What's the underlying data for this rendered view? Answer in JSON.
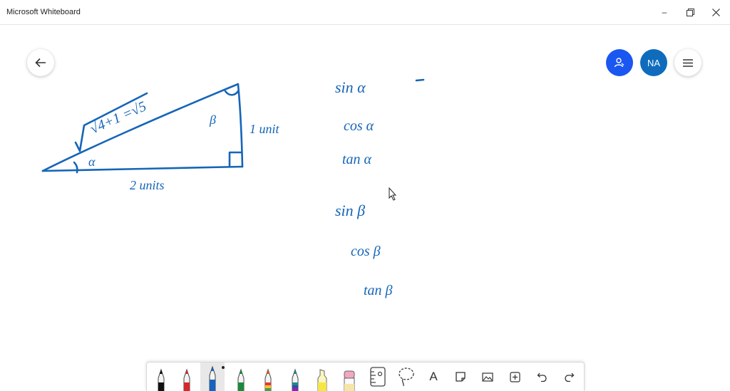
{
  "window": {
    "title": "Microsoft Whiteboard",
    "minimize_glyph": "–",
    "restore_glyph": "⧉",
    "close_glyph": "✕"
  },
  "nav": {
    "back_icon": "arrow-left-icon"
  },
  "header_right": {
    "share_icon": "invite-person-icon",
    "avatar_initials": "NA",
    "menu_icon": "hamburger-icon"
  },
  "ink": {
    "color": "#1565b8",
    "hypotenuse_label": "√4+1 =√5",
    "vertical_side_label": "1 unit",
    "base_label": "2 units",
    "angle_alpha": "α",
    "angle_beta": "β",
    "trig_list": [
      "sin α",
      "cos α",
      "tan α",
      "sin β",
      "cos β",
      "tan β"
    ]
  },
  "toolbar": {
    "tools": [
      {
        "name": "black-pen-tool",
        "color": "#111111"
      },
      {
        "name": "red-pen-tool",
        "color": "#d42a2a"
      },
      {
        "name": "blue-pen-tool",
        "color": "#1565c0",
        "selected": true
      },
      {
        "name": "green-pen-tool",
        "color": "#1c8a3c"
      },
      {
        "name": "rainbow-pen-tool",
        "color": "#e05a1b"
      },
      {
        "name": "galaxy-pen-tool",
        "color": "#1a8a8a"
      },
      {
        "name": "highlighter-tool",
        "color": "#f5e642"
      },
      {
        "name": "eraser-tool",
        "color": "#f2a7c3"
      },
      {
        "name": "ruler-tool",
        "icon": "ruler-icon"
      },
      {
        "name": "lasso-select-tool",
        "icon": "lasso-icon"
      },
      {
        "name": "text-tool",
        "icon": "text-a-icon",
        "glyph": "A"
      },
      {
        "name": "sticky-note-tool",
        "icon": "note-icon"
      },
      {
        "name": "image-tool",
        "icon": "image-icon"
      },
      {
        "name": "insert-tool",
        "icon": "plus-box-icon"
      },
      {
        "name": "undo-tool",
        "icon": "undo-icon"
      },
      {
        "name": "redo-tool",
        "icon": "redo-icon"
      }
    ]
  }
}
